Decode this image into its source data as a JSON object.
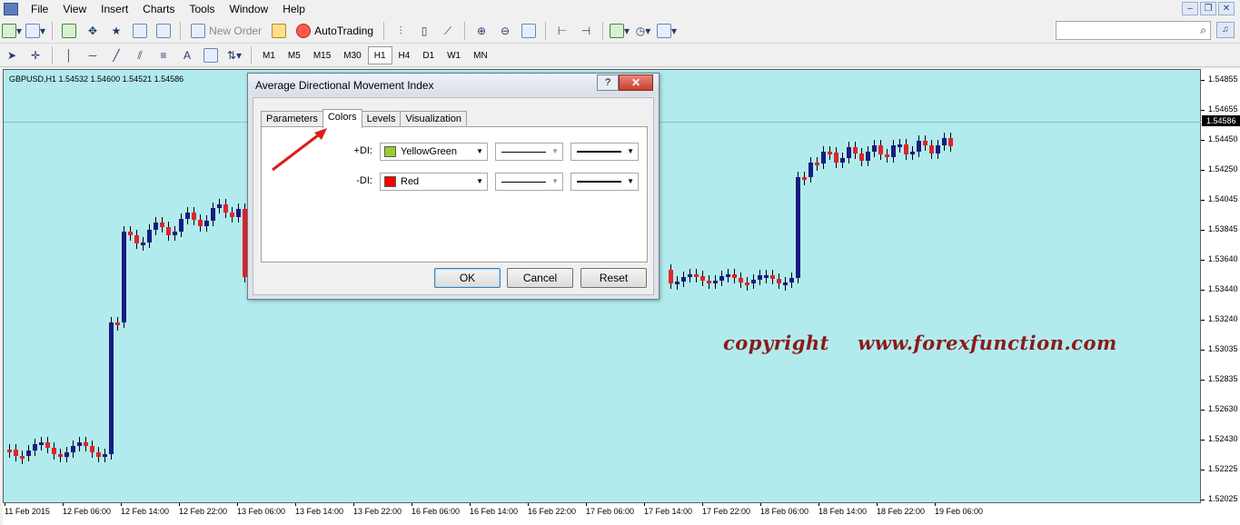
{
  "menu": [
    "File",
    "View",
    "Insert",
    "Charts",
    "Tools",
    "Window",
    "Help"
  ],
  "toolbar": {
    "new_order_label": "New Order",
    "autotrading_label": "AutoTrading",
    "timeframes": [
      "M1",
      "M5",
      "M15",
      "M30",
      "H1",
      "H4",
      "D1",
      "W1",
      "MN"
    ],
    "active_timeframe": "H1"
  },
  "chart": {
    "symbol_info": "GBPUSD,H1  1.54532 1.54600 1.54521 1.54586",
    "current_price": "1.54586",
    "watermark": "copyright    www.forexfunction.com",
    "price_labels": [
      "1.54855",
      "1.54655",
      "1.54450",
      "1.54250",
      "1.54045",
      "1.53845",
      "1.53640",
      "1.53440",
      "1.53240",
      "1.53035",
      "1.52835",
      "1.52630",
      "1.52430",
      "1.52225",
      "1.52025"
    ],
    "time_labels": [
      "11 Feb 2015",
      "12 Feb 06:00",
      "12 Feb 14:00",
      "12 Feb 22:00",
      "13 Feb 06:00",
      "13 Feb 14:00",
      "13 Feb 22:00",
      "16 Feb 06:00",
      "16 Feb 14:00",
      "16 Feb 22:00",
      "17 Feb 06:00",
      "17 Feb 14:00",
      "17 Feb 22:00",
      "18 Feb 06:00",
      "18 Feb 14:00",
      "18 Feb 22:00",
      "19 Feb 06:00"
    ],
    "colors": {
      "background": "#b2ebee",
      "bull": "#1a1a80",
      "bear": "#e0242a"
    }
  },
  "dialog": {
    "title": "Average Directional Movement Index",
    "help": "?",
    "close": "✕",
    "tabs": [
      "Parameters",
      "Colors",
      "Levels",
      "Visualization"
    ],
    "active_tab": "Colors",
    "rows": [
      {
        "label": "+DI:",
        "color_name": "YellowGreen",
        "color": "#9acd32"
      },
      {
        "label": "-DI:",
        "color_name": "Red",
        "color": "#ff0000"
      }
    ],
    "buttons": {
      "ok": "OK",
      "cancel": "Cancel",
      "reset": "Reset"
    }
  }
}
